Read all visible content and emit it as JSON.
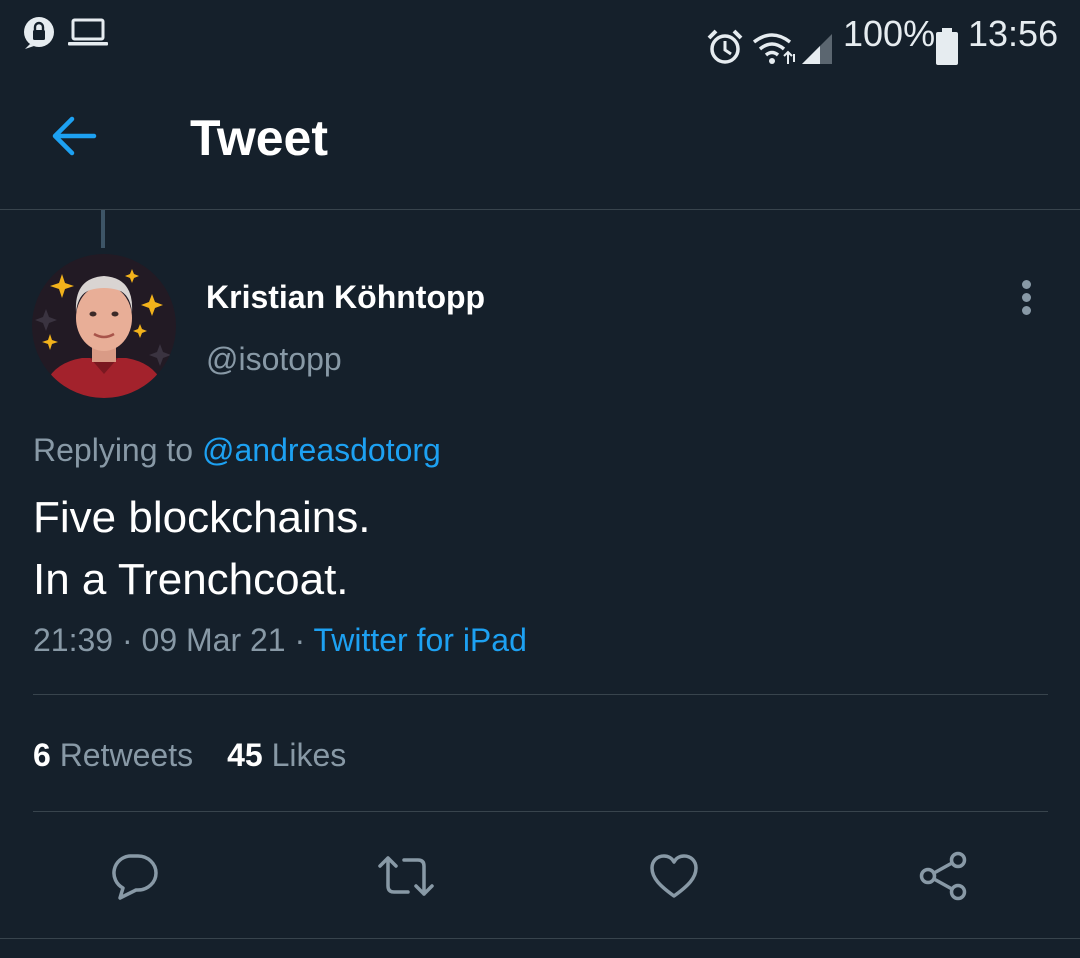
{
  "status_bar": {
    "battery_percent": "100%",
    "time": "13:56",
    "icons": [
      "lock-notification-icon",
      "laptop-icon",
      "alarm-icon",
      "wifi-icon",
      "signal-icon",
      "battery-icon"
    ]
  },
  "header": {
    "title": "Tweet",
    "back_icon": "arrow-left-icon"
  },
  "tweet": {
    "author": {
      "display_name": "Kristian Köhntopp",
      "handle": "@isotopp"
    },
    "replying_prefix": "Replying to",
    "replying_to": "@andreasdotorg",
    "text": "Five blockchains.\nIn a Trenchcoat.",
    "time": "21:39",
    "date": "09 Mar 21",
    "source": "Twitter for iPad",
    "separator": "·",
    "retweet_count": "6",
    "retweet_label": "Retweets",
    "like_count": "45",
    "like_label": "Likes"
  },
  "actions": [
    "reply-icon",
    "retweet-icon",
    "like-icon",
    "share-icon"
  ],
  "colors": {
    "background": "#15202b",
    "accent": "#1da1f2",
    "secondary_text": "#8899a6",
    "divider": "#38444d"
  }
}
